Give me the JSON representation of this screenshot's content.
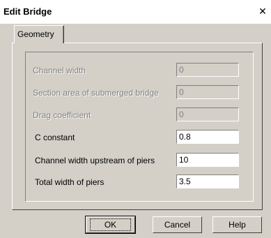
{
  "window": {
    "title": "Edit Bridge",
    "close_symbol": "✕"
  },
  "tabs": [
    {
      "label": "Geometry",
      "active": true
    }
  ],
  "fields": [
    {
      "label": "Channel width",
      "value": "0",
      "enabled": false
    },
    {
      "label": "Section area of submerged bridge",
      "value": "0",
      "enabled": false
    },
    {
      "label": "Drag coefficient",
      "value": "0",
      "enabled": false
    },
    {
      "label": "C constant",
      "value": "0.8",
      "enabled": true
    },
    {
      "label": "Channel width upstream of piers",
      "value": "10",
      "enabled": true
    },
    {
      "label": "Total width of piers",
      "value": "3.5",
      "enabled": true
    }
  ],
  "buttons": {
    "ok": "OK",
    "cancel": "Cancel",
    "help": "Help"
  }
}
